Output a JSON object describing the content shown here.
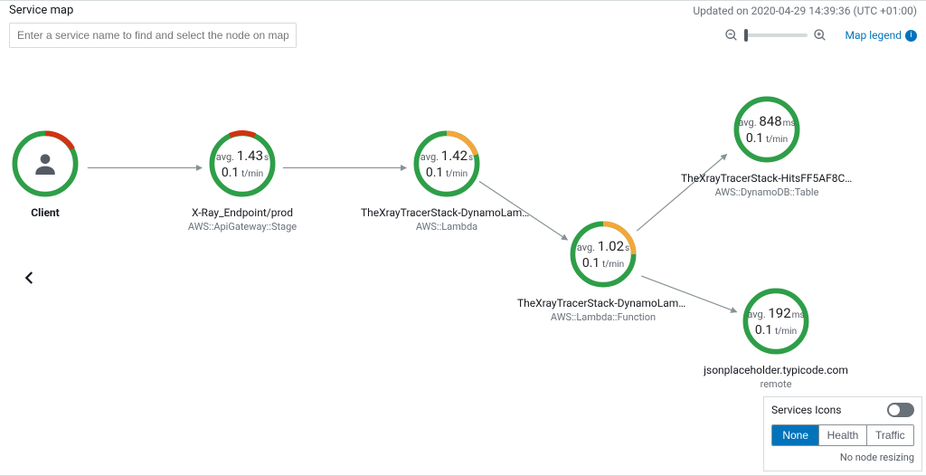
{
  "header": {
    "title": "Service map",
    "updated": "Updated on 2020-04-29 14:39:36 (UTC +01:00)"
  },
  "toolbar": {
    "search_placeholder": "Enter a service name to find and select the node on map",
    "legend_label": "Map legend"
  },
  "nodes": {
    "client": {
      "label": "Client"
    },
    "apigw": {
      "avg_value": "1.43",
      "avg_unit": "s",
      "tmin_value": "0.1",
      "tmin_unit": "t/min",
      "label": "X-Ray_Endpoint/prod",
      "sublabel": "AWS::ApiGateway::Stage"
    },
    "lambda1": {
      "avg_value": "1.42",
      "avg_unit": "s",
      "tmin_value": "0.1",
      "tmin_unit": "t/min",
      "label": "TheXrayTracerStack-DynamoLambd...",
      "sublabel": "AWS::Lambda"
    },
    "lambdafn": {
      "avg_value": "1.02",
      "avg_unit": "s",
      "tmin_value": "0.1",
      "tmin_unit": "t/min",
      "label": "TheXrayTracerStack-DynamoLambd...",
      "sublabel": "AWS::Lambda::Function"
    },
    "ddb": {
      "avg_value": "848",
      "avg_unit": "ms",
      "tmin_value": "0.1",
      "tmin_unit": "t/min",
      "label": "TheXrayTracerStack-HitsFF5AF8C...",
      "sublabel": "AWS::DynamoDB::Table"
    },
    "remote": {
      "avg_value": "192",
      "avg_unit": "ms",
      "tmin_value": "0.1",
      "tmin_unit": "t/min",
      "label": "jsonplaceholder.typicode.com",
      "sublabel": "remote"
    }
  },
  "panel": {
    "services_icons": "Services Icons",
    "seg": {
      "none": "None",
      "health": "Health",
      "traffic": "Traffic"
    },
    "resize_note": "No node resizing"
  },
  "colors": {
    "ok": "#2e9e48",
    "err": "#d13212",
    "warn": "#f2a73b",
    "edge": "#879196",
    "link": "#0073bb"
  }
}
